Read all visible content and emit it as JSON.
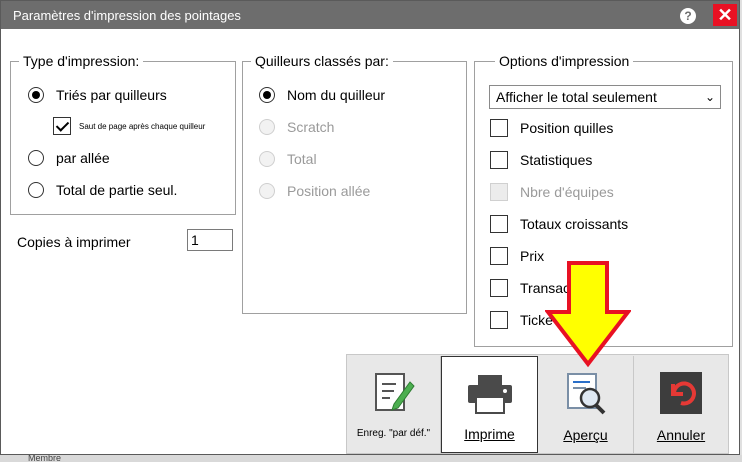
{
  "window": {
    "title": "Paramètres d'impression des pointages",
    "help_glyph": "?",
    "close_glyph": "✕"
  },
  "background": {
    "text_1": "Membre"
  },
  "print_type": {
    "legend": "Type d'impression:",
    "options": [
      {
        "label": "Triés par quilleurs",
        "selected": true
      },
      {
        "label": "par allée",
        "selected": false
      },
      {
        "label": "Total de partie seul.",
        "selected": false
      }
    ],
    "page_break": {
      "label": "Saut de page après chaque quilleur",
      "checked": true
    }
  },
  "copies": {
    "label": "Copies à imprimer",
    "value": "1"
  },
  "sorted_by": {
    "legend": "Quilleurs classés par:",
    "options": [
      {
        "label": "Nom du quilleur",
        "selected": true,
        "enabled": true
      },
      {
        "label": "Scratch",
        "selected": false,
        "enabled": false
      },
      {
        "label": "Total",
        "selected": false,
        "enabled": false
      },
      {
        "label": "Position allée",
        "selected": false,
        "enabled": false
      }
    ]
  },
  "print_options": {
    "legend": "Options d'impression",
    "select_value": "Afficher le total seulement",
    "checkboxes": [
      {
        "label": "Position quilles",
        "checked": false,
        "enabled": true
      },
      {
        "label": "Statistiques",
        "checked": false,
        "enabled": true
      },
      {
        "label": "Nbre d'équipes",
        "checked": false,
        "enabled": false
      },
      {
        "label": "Totaux croissants",
        "checked": false,
        "enabled": true
      },
      {
        "label": "Prix",
        "checked": false,
        "enabled": true
      },
      {
        "label": "Transac",
        "checked": false,
        "enabled": true
      },
      {
        "label": "Ticke",
        "checked": false,
        "enabled": true
      }
    ]
  },
  "footer": {
    "save_default": "Enreg. \"par déf.\"",
    "print": "Imprime",
    "preview": "Aperçu",
    "cancel": "Annuler"
  },
  "colors": {
    "titlebar": "#6d6d6d",
    "close": "#e81123",
    "arrow_fill": "#ffff00",
    "arrow_stroke": "#e81123"
  }
}
